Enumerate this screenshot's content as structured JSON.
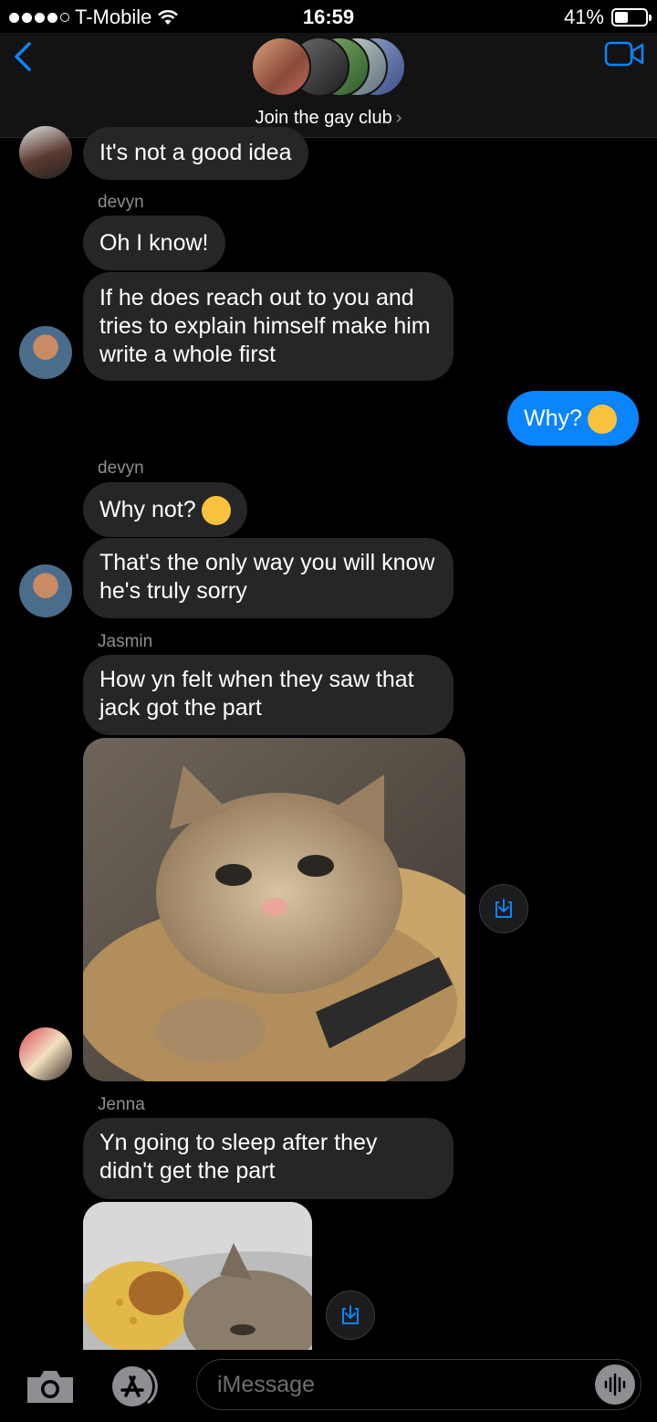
{
  "status_bar": {
    "carrier": "T-Mobile",
    "time": "16:59",
    "battery": "41%"
  },
  "header": {
    "group_name": "Join the gay club",
    "chevron": "›"
  },
  "messages": [
    {
      "text": "It's not a good idea"
    },
    {
      "sender": "devyn"
    },
    {
      "text": "Oh I know!"
    },
    {
      "text": "If he does reach out to you and tries to explain himself make him write a whole first"
    },
    {
      "text": "Why?"
    },
    {
      "sender": "devyn"
    },
    {
      "text": "Why not?"
    },
    {
      "text": "That's the only way you will know he's truly sorry"
    },
    {
      "sender": "Jasmin"
    },
    {
      "text": "How yn felt when they saw that jack got the part"
    },
    {
      "sender": "Jenna"
    },
    {
      "text": "Yn going to sleep after they didn't get the part"
    }
  ],
  "icons": {
    "back": "chevron-left-icon",
    "video": "video-camera-icon",
    "camera": "camera-icon",
    "apps": "app-store-icon",
    "audio": "audio-waveform-icon",
    "save": "download-icon"
  },
  "colors": {
    "outgoing_bubble": "#0a84ff",
    "incoming_bubble": "#262628",
    "accent": "#0a84ff"
  },
  "input": {
    "placeholder": "iMessage"
  }
}
